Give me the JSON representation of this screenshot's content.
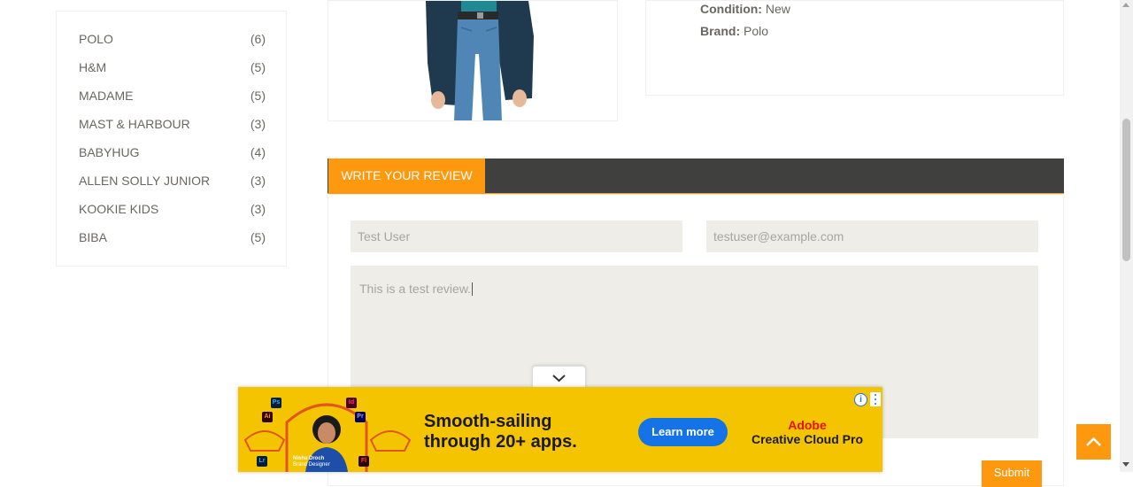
{
  "sidebar": {
    "brands": [
      {
        "name": "POLO",
        "count": "(6)"
      },
      {
        "name": "H&M",
        "count": "(5)"
      },
      {
        "name": "MADAME",
        "count": "(5)"
      },
      {
        "name": "MAST & HARBOUR",
        "count": "(3)"
      },
      {
        "name": "BABYHUG",
        "count": "(4)"
      },
      {
        "name": "ALLEN SOLLY JUNIOR",
        "count": "(3)"
      },
      {
        "name": "KOOKIE KIDS",
        "count": "(3)"
      },
      {
        "name": "BIBA",
        "count": "(5)"
      }
    ]
  },
  "product": {
    "condition_label": "Condition:",
    "condition_value": "New",
    "brand_label": "Brand:",
    "brand_value": "Polo"
  },
  "review": {
    "tab_label": "Write Your Review",
    "name_value": "Test User",
    "email_value": "testuser@example.com",
    "review_value": "This is a test review.",
    "submit_label": "Submit"
  },
  "ad": {
    "headline_line1": "Smooth-sailing",
    "headline_line2": "through 20+ apps.",
    "cta_label": "Learn more",
    "brand_line1": "Adobe",
    "brand_line2": "Creative Cloud Pro",
    "person_name": "Nisha Droch",
    "person_title": "Brand Designer",
    "app_icons": [
      "Ps",
      "Id",
      "Ai",
      "Pr",
      "Lr",
      "Fl"
    ],
    "info_glyph": "i"
  },
  "colors": {
    "accent": "#fe980f",
    "review_bar": "#40403e",
    "field_bg": "#eeede7",
    "ad_bg": "#f5c400",
    "ad_cta": "#1473e6"
  }
}
